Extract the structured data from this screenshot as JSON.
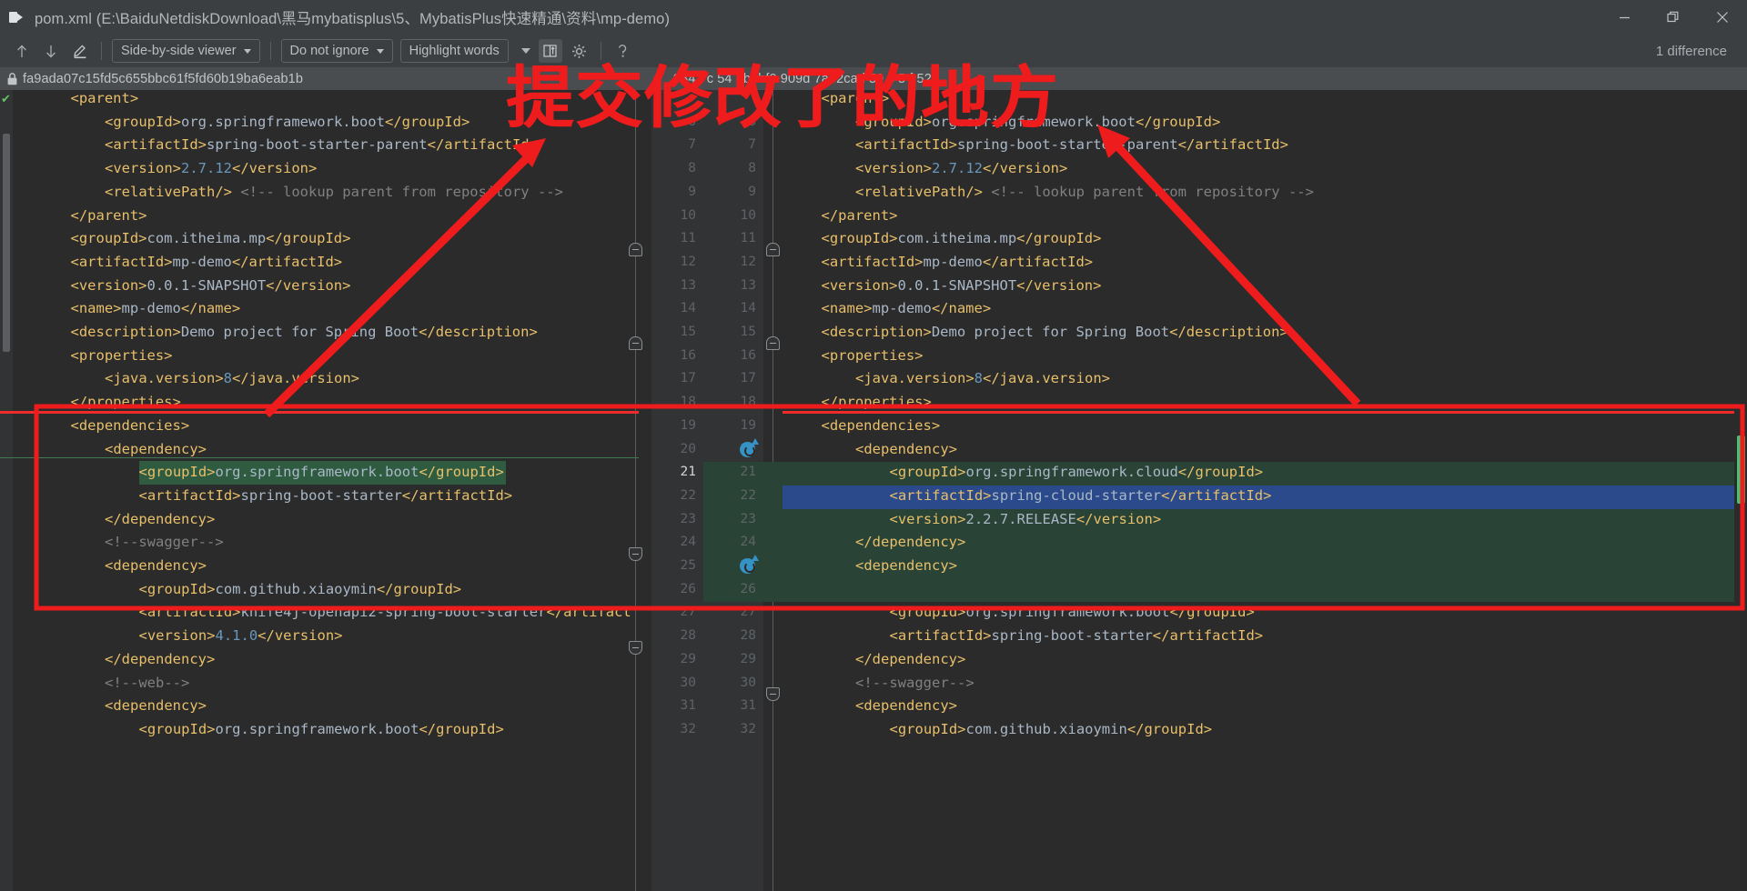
{
  "window": {
    "title": "pom.xml (E:\\BaiduNetdiskDownload\\黑马mybatisplus\\5、MybatisPlus快速精通\\资料\\mp-demo)",
    "app_icon": "diff-window-icon",
    "minimize": "−",
    "maximize": "❐",
    "close": "✕"
  },
  "toolbar": {
    "prev_diff_icon": "arrow-up-icon",
    "next_diff_icon": "arrow-down-icon",
    "edit_icon": "pencil-underline-icon",
    "viewer_mode": "Side-by-side viewer",
    "ignore_mode": "Do not ignore",
    "highlight_mode": "Highlight words",
    "collapse_caret_icon": "chevron-down-icon",
    "sync_scroll_icon": "synchronize-scroll-icon",
    "settings_icon": "gear-icon",
    "help_icon": "help-icon",
    "difference_count": "1 difference"
  },
  "hashbar": {
    "lock_icon": "lock-icon",
    "left_hash": "fa9ada07c15fd5c655bbc61f5fd60b19ba6eab1b",
    "right_hash": "9347 c  54 7b1bf0 909d 7a52cad 59 c 5 f 52"
  },
  "annotation": {
    "text": "提交修改了的地方",
    "color": "#ee1c1c",
    "box_color": "#ee1c1c"
  },
  "left_pane": {
    "status_ok_icon": "check-icon",
    "lines": [
      {
        "n": "",
        "indent": 1,
        "text": "<parent>",
        "kind": "tag"
      },
      {
        "n": "",
        "indent": 2,
        "text": "<groupId>org.springframework.boot</groupId>",
        "kind": "mixed"
      },
      {
        "n": "",
        "indent": 2,
        "text": "<artifactId>spring-boot-starter-parent</artifactId>",
        "kind": "mixed"
      },
      {
        "n": "",
        "indent": 2,
        "text": "<version>2.7.12</version>",
        "kind": "mixed"
      },
      {
        "n": "",
        "indent": 2,
        "text": "<relativePath/> <!-- lookup parent from repository -->",
        "kind": "tagcomment"
      },
      {
        "n": "",
        "indent": 1,
        "text": "</parent>",
        "kind": "tag"
      },
      {
        "n": "",
        "indent": 1,
        "text": "<groupId>com.itheima.mp</groupId>",
        "kind": "mixed"
      },
      {
        "n": "",
        "indent": 1,
        "text": "<artifactId>mp-demo</artifactId>",
        "kind": "mixed"
      },
      {
        "n": "",
        "indent": 1,
        "text": "<version>0.0.1-SNAPSHOT</version>",
        "kind": "mixed"
      },
      {
        "n": "",
        "indent": 1,
        "text": "<name>mp-demo</name>",
        "kind": "mixed"
      },
      {
        "n": "",
        "indent": 1,
        "text": "<description>Demo project for Spring Boot</description>",
        "kind": "mixed"
      },
      {
        "n": "",
        "indent": 1,
        "text": "<properties>",
        "kind": "tag"
      },
      {
        "n": "",
        "indent": 2,
        "text": "<java.version>8</java.version>",
        "kind": "mixed"
      },
      {
        "n": "",
        "indent": 1,
        "text": "</properties>",
        "kind": "tag"
      },
      {
        "n": "",
        "indent": 1,
        "text": "<dependencies>",
        "kind": "tag"
      },
      {
        "n": "",
        "indent": 2,
        "text": "<dependency>",
        "kind": "tag"
      },
      {
        "n": "",
        "indent": 3,
        "text": "<groupId>org.springframework.boot</groupId>",
        "kind": "mixed",
        "highlight": "inline-green"
      },
      {
        "n": "",
        "indent": 3,
        "text": "<artifactId>spring-boot-starter</artifactId>",
        "kind": "mixed"
      },
      {
        "n": "",
        "indent": 2,
        "text": "</dependency>",
        "kind": "tag"
      },
      {
        "n": "",
        "indent": 2,
        "text": "<!--swagger-->",
        "kind": "comment"
      },
      {
        "n": "",
        "indent": 2,
        "text": "<dependency>",
        "kind": "tag"
      },
      {
        "n": "",
        "indent": 3,
        "text": "<groupId>com.github.xiaoymin</groupId>",
        "kind": "mixed"
      },
      {
        "n": "",
        "indent": 3,
        "text": "<artifactId>knife4j-openapi2-spring-boot-starter</artifact",
        "kind": "mixed"
      },
      {
        "n": "",
        "indent": 3,
        "text": "<version>4.1.0</version>",
        "kind": "mixed"
      },
      {
        "n": "",
        "indent": 2,
        "text": "</dependency>",
        "kind": "tag"
      },
      {
        "n": "",
        "indent": 2,
        "text": "<!--web-->",
        "kind": "comment"
      },
      {
        "n": "",
        "indent": 2,
        "text": "<dependency>",
        "kind": "tag"
      },
      {
        "n": "",
        "indent": 3,
        "text": "<groupId>org.springframework.boot</groupId>",
        "kind": "mixed"
      }
    ]
  },
  "right_pane": {
    "status_ok_icon": "check-icon",
    "line_numbers_left": [
      "",
      "6",
      "7",
      "8",
      "9",
      "10",
      "11",
      "12",
      "13",
      "14",
      "15",
      "16",
      "17",
      "18",
      "19",
      "20",
      "21",
      "22",
      "23",
      "24",
      "25",
      "26",
      "27",
      "28",
      "29",
      "30",
      "31",
      "32"
    ],
    "line_numbers_right": [
      "",
      "6",
      "7",
      "8",
      "9",
      "10",
      "11",
      "12",
      "13",
      "14",
      "15",
      "16",
      "17",
      "18",
      "19",
      "20",
      "21",
      "22",
      "23",
      "24",
      "25",
      "26",
      "27",
      "28",
      "29",
      "30",
      "31",
      "32"
    ],
    "current_line": "21",
    "lines": [
      {
        "indent": 1,
        "text": "<parent>",
        "kind": "tag"
      },
      {
        "indent": 2,
        "text": "<groupId>org.springframework.boot</groupId>",
        "kind": "mixed"
      },
      {
        "indent": 2,
        "text": "<artifactId>spring-boot-starter-parent</artifactId>",
        "kind": "mixed"
      },
      {
        "indent": 2,
        "text": "<version>2.7.12</version>",
        "kind": "mixed"
      },
      {
        "indent": 2,
        "text": "<relativePath/> <!-- lookup parent from repository -->",
        "kind": "tagcomment"
      },
      {
        "indent": 1,
        "text": "</parent>",
        "kind": "tag"
      },
      {
        "indent": 1,
        "text": "<groupId>com.itheima.mp</groupId>",
        "kind": "mixed"
      },
      {
        "indent": 1,
        "text": "<artifactId>mp-demo</artifactId>",
        "kind": "mixed"
      },
      {
        "indent": 1,
        "text": "<version>0.0.1-SNAPSHOT</version>",
        "kind": "mixed"
      },
      {
        "indent": 1,
        "text": "<name>mp-demo</name>",
        "kind": "mixed"
      },
      {
        "indent": 1,
        "text": "<description>Demo project for Spring Boot</description>",
        "kind": "mixed"
      },
      {
        "indent": 1,
        "text": "<properties>",
        "kind": "tag"
      },
      {
        "indent": 2,
        "text": "<java.version>8</java.version>",
        "kind": "mixed"
      },
      {
        "indent": 1,
        "text": "</properties>",
        "kind": "tag"
      },
      {
        "indent": 1,
        "text": "<dependencies>",
        "kind": "tag"
      },
      {
        "indent": 2,
        "text": "<dependency>",
        "kind": "tag"
      },
      {
        "indent": 3,
        "text": "<groupId>org.springframework.cloud</groupId>",
        "kind": "mixed"
      },
      {
        "indent": 3,
        "text": "<artifactId>spring-cloud-starter</artifactId>",
        "kind": "mixed"
      },
      {
        "indent": 3,
        "text": "<version>2.2.7.RELEASE</version>",
        "kind": "mixed"
      },
      {
        "indent": 2,
        "text": "</dependency>",
        "kind": "tag"
      },
      {
        "indent": 2,
        "text": "<dependency>",
        "kind": "tag"
      },
      {
        "indent": 2,
        "text": "",
        "kind": "tag"
      },
      {
        "indent": 3,
        "text": "<groupId>org.springframework.boot</groupId>",
        "kind": "mixed"
      },
      {
        "indent": 3,
        "text": "<artifactId>spring-boot-starter</artifactId>",
        "kind": "mixed"
      },
      {
        "indent": 2,
        "text": "</dependency>",
        "kind": "tag"
      },
      {
        "indent": 2,
        "text": "<!--swagger-->",
        "kind": "comment"
      },
      {
        "indent": 2,
        "text": "<dependency>",
        "kind": "tag"
      },
      {
        "indent": 3,
        "text": "<groupId>com.github.xiaoymin</groupId>",
        "kind": "mixed"
      }
    ]
  },
  "colors": {
    "background": "#2b2b2b",
    "chrome": "#3c3f41",
    "gutter": "#313335",
    "added_row": "#294436",
    "changed_inline": "#2f5c41",
    "selection": "#2b4a8b",
    "tag": "#e8bf6a",
    "value": "#a9b7c6",
    "comment": "#808080",
    "number": "#6897bb",
    "accent_red": "#f02b2b",
    "git_icon": "#3592c4",
    "scroll_thumb": "#4bbf73"
  }
}
